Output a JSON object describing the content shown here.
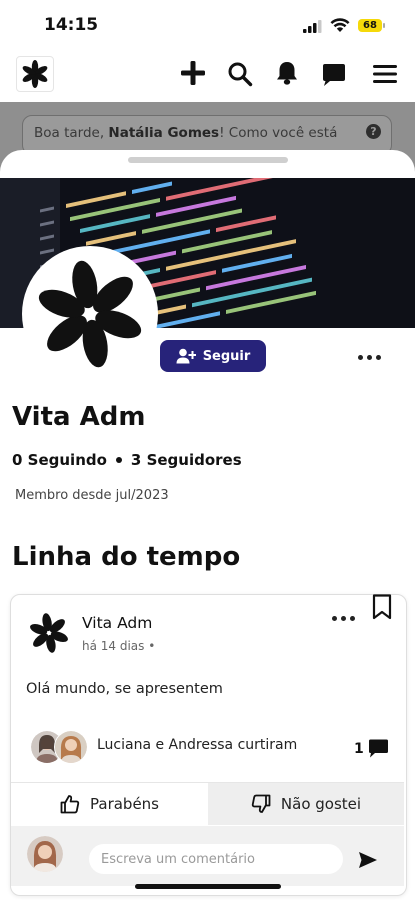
{
  "status_bar": {
    "time": "14:15",
    "battery": "68"
  },
  "header": {
    "icons": [
      "logo-leaf-icon",
      "plus-icon",
      "search-icon",
      "bell-icon",
      "chat-icon",
      "menu-icon"
    ]
  },
  "greeting": {
    "prefix": "Boa tarde, ",
    "name": "Natália Gomes",
    "suffix": "! Como você está"
  },
  "profile": {
    "follow_label": "Seguir",
    "name": "Vita Adm",
    "following": "0 Seguindo",
    "followers": "3 Seguidores",
    "member_since": "Membro desde jul/2023"
  },
  "timeline": {
    "title": "Linha do tempo",
    "post": {
      "author": "Vita Adm",
      "time": "há 14 dias •",
      "body": "Olá mundo, se apresentem",
      "likes_text": "Luciana e Andressa curtiram",
      "comment_count": "1",
      "like_label": "Parabéns",
      "dislike_label": "Não gostei",
      "comment_placeholder": "Escreva um comentário"
    }
  },
  "colors": {
    "accent": "#27237a",
    "overlay": "#8f8f8f",
    "battery": "#f5d90a"
  }
}
